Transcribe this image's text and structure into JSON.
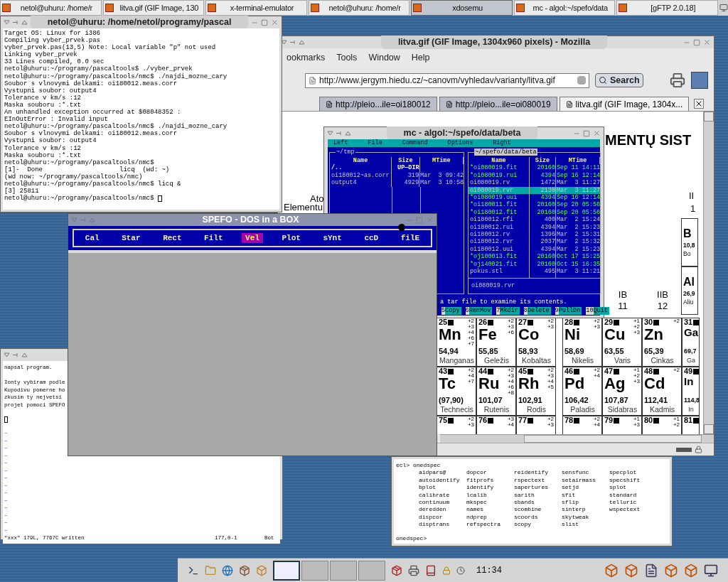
{
  "top_taskbar": {
    "tasks": [
      {
        "label": "netol@uhuru: /home/r",
        "selected": false
      },
      {
        "label": "litva.gif (GIF Image, 130",
        "selected": false
      },
      {
        "label": "x-terminal-emulator",
        "selected": false
      },
      {
        "label": "netol@uhuru: /home/r",
        "selected": false
      },
      {
        "label": "xdosemu",
        "selected": true
      },
      {
        "label": "mc - algol:~/spefo/data",
        "selected": false
      },
      {
        "label": "[gFTP 2.0.18]",
        "selected": false
      }
    ]
  },
  "browser": {
    "title": "litva.gif (GIF Image, 1304x960 pixels) - Mozilla",
    "menu": [
      "ookmarks",
      "Tools",
      "Window",
      "Help"
    ],
    "url": "http://www.jergym.hiedu.cz/~canovm/vyhledav/varianty/litva.gif",
    "search_button": "Search",
    "tabs": [
      {
        "label": "http://pleio...ile=oi180012",
        "selected": false
      },
      {
        "label": "http://pleio...ile=oi080019",
        "selected": false
      },
      {
        "label": "litva.gif (GIF Image, 1304x...",
        "selected": true
      }
    ],
    "image": {
      "heading": "MENTŲ SIST",
      "left_labels": [
        "Ato",
        "Elementu"
      ],
      "corner_labels": [
        "II",
        "1"
      ],
      "groups": [
        {
          "name": "IB",
          "number": "11"
        },
        {
          "name": "IIB",
          "number": "12"
        }
      ],
      "side_cells": [
        {
          "symbol": "B",
          "mass": "10,8",
          "name": "Bo"
        },
        {
          "symbol": "Al",
          "mass": "26,9",
          "name": "Aliu"
        }
      ],
      "rows": [
        [
          {
            "number": "25",
            "symbol": "Mn",
            "states": [
              "+2",
              "+3",
              "+4",
              "+6",
              "+7"
            ],
            "mass": "54,94",
            "name": "Manganas"
          },
          {
            "number": "26",
            "symbol": "Fe",
            "states": [
              "+2",
              "+3",
              "+6"
            ],
            "mass": "55,85",
            "name": "Geležis"
          },
          {
            "number": "27",
            "symbol": "Co",
            "states": [
              "+2",
              "+3"
            ],
            "mass": "58,93",
            "name": "Kobaltas"
          },
          {
            "number": "28",
            "symbol": "Ni",
            "states": [
              "+2",
              "+3"
            ],
            "mass": "58,69",
            "name": "Nikelis"
          },
          {
            "number": "29",
            "symbol": "Cu",
            "states": [
              "+1",
              "+2",
              "+3"
            ],
            "mass": "63,55",
            "name": "Varis"
          },
          {
            "number": "30",
            "symbol": "Zn",
            "states": [
              "+2"
            ],
            "mass": "65,39",
            "name": "Cinkas"
          },
          {
            "number": "31",
            "symbol": "Ga",
            "mass": "69,7",
            "name": "Ga"
          }
        ],
        [
          {
            "number": "43",
            "symbol": "Tc",
            "states": [
              "+2",
              "+4",
              "+7"
            ],
            "mass": "(97,90)",
            "name": "Technecis"
          },
          {
            "number": "44",
            "symbol": "Ru",
            "states": [
              "+2",
              "+3",
              "+4",
              "+6",
              "+8"
            ],
            "mass": "101,07",
            "name": "Rutenis"
          },
          {
            "number": "45",
            "symbol": "Rh",
            "states": [
              "+2",
              "+3",
              "+4",
              "+5"
            ],
            "mass": "102,91",
            "name": "Rodis"
          },
          {
            "number": "46",
            "symbol": "Pd",
            "states": [
              "+2",
              "+4"
            ],
            "mass": "106,42",
            "name": "Paladis"
          },
          {
            "number": "47",
            "symbol": "Ag",
            "states": [
              "+1",
              "+2",
              "+3"
            ],
            "mass": "107,87",
            "name": "Sidabras"
          },
          {
            "number": "48",
            "symbol": "Cd",
            "states": [
              "+2"
            ],
            "mass": "112,41",
            "name": "Kadmis"
          },
          {
            "number": "49",
            "symbol": "In",
            "mass": "114,8",
            "name": "In"
          }
        ],
        [
          {
            "number": "75",
            "states": [
              "+2",
              "+3"
            ]
          },
          {
            "number": "76",
            "states": [
              "+3",
              "+4"
            ]
          },
          {
            "number": "77",
            "states": [
              "+2",
              "+3"
            ]
          },
          {
            "number": "78",
            "states": [
              "+2",
              "+4"
            ]
          },
          {
            "number": "79",
            "states": [
              "+1",
              "+3"
            ]
          },
          {
            "number": "80",
            "states": [
              "+1",
              "+2"
            ]
          },
          {
            "number": "81"
          }
        ]
      ]
    }
  },
  "mc": {
    "title": "mc - algol:~/spefo/data/beta",
    "menu": [
      "Left",
      "File",
      "Command",
      "Options",
      "Right"
    ],
    "left_panel": {
      "path": "~/tmp",
      "columns": [
        "Name",
        "Size",
        "MTime"
      ],
      "rows": [
        {
          "name": "/..",
          "size": "UP—DIR",
          "mtime": "",
          "kind": "dir",
          "selected": false
        },
        {
          "name": "oi180012~as.corr",
          "size": "319",
          "mtime": "Mar  3 09:42",
          "kind": "file",
          "selected": false
        },
        {
          "name": "output4",
          "size": "4929",
          "mtime": "Mar  3 10:58",
          "kind": "file",
          "selected": false
        }
      ]
    },
    "right_panel": {
      "path": "~/spefo/data/beta",
      "columns": [
        "Name",
        "Size",
        "MTime"
      ],
      "rows": [
        {
          "name": "*oi080019.fit",
          "size": "20160",
          "mtime": "Sep 11 14:11",
          "kind": "exec",
          "selected": false
        },
        {
          "name": "*oi080019.rui",
          "size": "4394",
          "mtime": "Sep 16 12:14",
          "kind": "exec",
          "selected": false
        },
        {
          "name": "oi080019.rv",
          "size": "1472",
          "mtime": "Mar  3 11:27",
          "kind": "file",
          "selected": false
        },
        {
          "name": "oi080019.rvr",
          "size": "2130",
          "mtime": "Mar  3 11:27",
          "kind": "file",
          "selected": true
        },
        {
          "name": "*oi080019.uui",
          "size": "4394",
          "mtime": "Sep 16 12:14",
          "kind": "exec",
          "selected": false
        },
        {
          "name": "*oi180011.fit",
          "size": "20160",
          "mtime": "Sep 20 05:56",
          "kind": "exec",
          "selected": false
        },
        {
          "name": "*oi180012.fit",
          "size": "20160",
          "mtime": "Sep 20 05:56",
          "kind": "exec",
          "selected": false
        },
        {
          "name": "oi180012.rfi",
          "size": "400",
          "mtime": "Mar  2 15:24",
          "kind": "file",
          "selected": false
        },
        {
          "name": "oi180012.rui",
          "size": "4394",
          "mtime": "Mar  2 15:23",
          "kind": "file",
          "selected": false
        },
        {
          "name": "oi180012.rv",
          "size": "1396",
          "mtime": "Mar  2 15:31",
          "kind": "file",
          "selected": false
        },
        {
          "name": "oi180012.rvr",
          "size": "2037",
          "mtime": "Mar  2 15:32",
          "kind": "file",
          "selected": false
        },
        {
          "name": "oi180012.uui",
          "size": "4394",
          "mtime": "Mar  2 15:23",
          "kind": "file",
          "selected": false
        },
        {
          "name": "*oj100013.fit",
          "size": "20160",
          "mtime": "Oct 17 15:25",
          "kind": "exec",
          "selected": false
        },
        {
          "name": "*oj140021.fit",
          "size": "20160",
          "mtime": "Oct 15 16:35",
          "kind": "exec",
          "selected": false
        },
        {
          "name": "pokus.stl",
          "size": "495",
          "mtime": "Mar  3 11:21",
          "kind": "file",
          "selected": false
        }
      ],
      "status": "oi080019.rvr"
    },
    "hint": "a tar file to examine its contents.",
    "fkeys": [
      {
        "number": "5",
        "label": "Copy"
      },
      {
        "number": "6",
        "label": "RenMov"
      },
      {
        "number": "7",
        "label": "Mkdir"
      },
      {
        "number": "8",
        "label": "Delete"
      },
      {
        "number": "9",
        "label": "PullDn"
      },
      {
        "number": "10",
        "label": "Quit"
      }
    ]
  },
  "terminal": {
    "title": "netol@uhuru: /home/netol/programy/pascal",
    "lines": [
      "Target OS: Linux for i386",
      "Compiling vyber_prvek.pas",
      "vyber_prvek.pas(13,5) Note: Local variable \"p\" not used",
      "Linking vyber_prvek",
      "33 Lines compiled, 0.0 sec",
      "netol@uhuru:~/programy/pascaltools$ ./vyber_prvek",
      "netol@uhuru:~/programy/pascaltools/nmc$ ./najdi_mozne_cary",
      "Soubor s vlnovymi delkami: oi180012.meas.corr",
      "Vystupni soubor: output4",
      "Tolerance v km/s :12",
      "Maska souboru :*.txt",
      "An unhandled exception occurred at $08048352 :",
      "EInOutError : Invalid input",
      "netol@uhuru:~/programy/pascaltools/nmc$ ./najdi_mozne_cary",
      "Soubor s vlnovymi delkami: oi180012.meas.corr",
      "Vystupni soubor: output4",
      "Tolerance v km/s :12",
      "Maska souboru :*.txt",
      "netol@uhuru:~/programy/pascaltools/nmc$",
      "[1]-  Done                    licq  (wd: ~)",
      "(wd now: ~/programy/pascaltools/nmc)",
      "netol@uhuru:~/programy/pascaltools/nmc$ licq &",
      "[3] 25811",
      "netol@uhuru:~/programy/pascaltools/nmc$ "
    ]
  },
  "spefo": {
    "title": "SPEFO - DOS in a BOX",
    "menu": [
      {
        "label": "Cal",
        "selected": false
      },
      {
        "label": "Star",
        "selected": false
      },
      {
        "label": "Rect",
        "selected": false
      },
      {
        "label": "Filt",
        "selected": false
      },
      {
        "label": "Vel",
        "selected": true
      },
      {
        "label": "Plot",
        "selected": false
      },
      {
        "label": "sYnt",
        "selected": false
      },
      {
        "label": "ccD",
        "selected": false
      },
      {
        "label": "filE",
        "selected": false
      }
    ]
  },
  "vim": {
    "paragraphs": [
      [
        "napsal program."
      ],
      [
        "Ionty vybiram podle",
        "Kupodivu pomerne ho",
        "zkusim ty nejvetsi",
        "projet pomoci SPEFO"
      ]
    ],
    "tildes": [
      "~",
      "~",
      "~",
      "~",
      "~",
      "~",
      "~",
      "~",
      "~",
      "~",
      "~",
      "~",
      "~",
      "~"
    ],
    "status": "\"xxx\" 179L, 7767C written",
    "position": "177,0-1",
    "scroll": "Bot"
  },
  "ecl": {
    "command": "ecl> onedspec",
    "columns": [
      [
        "aidpars@",
        "autoidentify",
        "bplot",
        "calibrate",
        "continuum",
        "deredden",
        "dispcor",
        "disptrans"
      ],
      [
        "dopcor",
        "fitprofs",
        "identify",
        "lcalib",
        "mkspec",
        "names",
        "ndprep",
        "refspectra"
      ],
      [
        "reidentify",
        "rspectext",
        "sapertures",
        "sarith",
        "sbands",
        "scombine",
        "scoords",
        "scopy"
      ],
      [
        "sensfunc",
        "setairmass",
        "setjd",
        "sfit",
        "sflip",
        "sinterp",
        "skytweak",
        "slist"
      ],
      [
        "specplot",
        "specshift",
        "splot",
        "standard",
        "telluric",
        "wspectext"
      ]
    ],
    "prompt": "onedspec>"
  },
  "bottom_panel": {
    "clock": "11:34"
  }
}
